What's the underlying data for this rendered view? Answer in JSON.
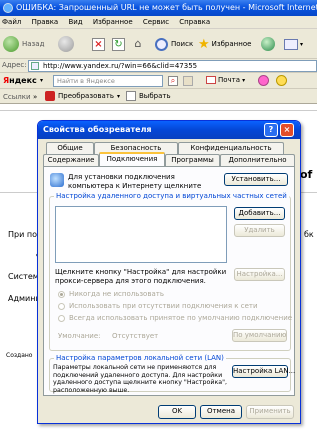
{
  "browser": {
    "title": "ОШИБКА: Запрошенный URL не может быть получен - Microsoft Internet Explorer",
    "menu": [
      "Файл",
      "Правка",
      "Вид",
      "Избранное",
      "Сервис",
      "Справка"
    ],
    "toolbar": {
      "back": "Назад",
      "search": "Поиск",
      "favorites": "Избранное"
    },
    "address": {
      "label": "Адрес:",
      "url": "http://www.yandex.ru/?win=66&clid=47355"
    },
    "yandex": {
      "logo_y": "Я",
      "logo_rest": "ндекс",
      "search_placeholder": "Найти в Яндексе",
      "mail": "Почта"
    },
    "links": {
      "label": "Ссылки",
      "convert": "Преобразовать",
      "select": "Выбрать"
    }
  },
  "page": {
    "line1": "При пол",
    "line2": "д",
    "line3": "Система",
    "line4": "Админи",
    "line5": "Создано",
    "right_frag": "of",
    "right_frag2": "бк"
  },
  "dialog": {
    "title": "Свойства обозревателя",
    "tabs_row1": [
      "Общие",
      "Безопасность",
      "Конфиденциальность"
    ],
    "tabs_row2": [
      "Содержание",
      "Подключения",
      "Программы",
      "Дополнительно"
    ],
    "setup_text": "Для установки подключения компьютера к Интернету щелкните эту кнопку.",
    "setup_button": "Установить...",
    "dialup_group": "Настройка удаленного доступа и виртуальных частных сетей",
    "add_button": "Добавить...",
    "remove_button": "Удалить",
    "settings_button": "Настройка...",
    "proxy_text": "Щелкните кнопку \"Настройка\" для настройки прокси-сервера для этого подключения.",
    "radio_options": [
      "Никогда не использовать",
      "Использовать при отсутствии подключения к сети",
      "Всегда использовать принятое по умолчанию подключение"
    ],
    "default_label": "Умолчание:",
    "default_value": "Отсутствует",
    "default_button": "По умолчанию",
    "lan_group": "Настройка параметров локальной сети (LAN)",
    "lan_text": "Параметры локальной сети не применяются для подключений удаленного доступа. Для настройки удаленного доступа щелкните кнопку \"Настройка\", расположенную выше.",
    "lan_button": "Настройка LAN...",
    "ok": "OK",
    "cancel": "Отмена",
    "apply": "Применить"
  }
}
